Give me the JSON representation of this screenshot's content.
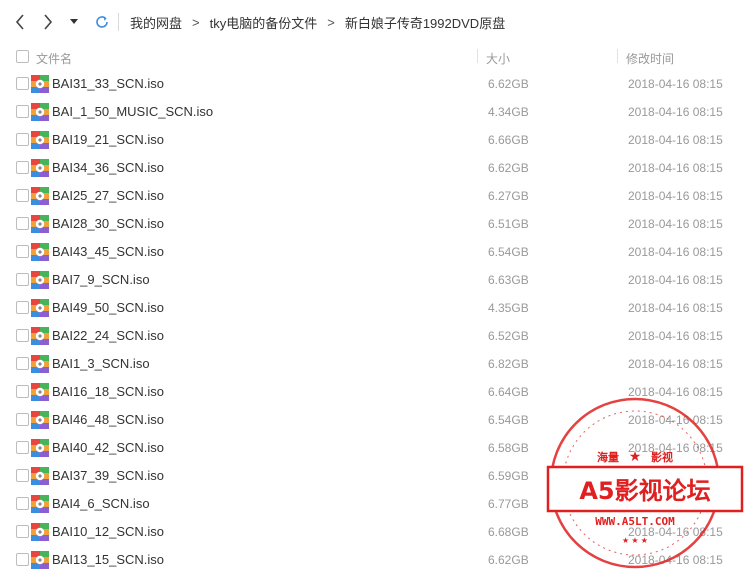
{
  "toolbar": {
    "back_icon": "chevron-left-icon",
    "forward_icon": "chevron-right-icon",
    "history_icon": "caret-down-icon",
    "refresh_icon": "refresh-icon"
  },
  "breadcrumb": [
    "我的网盘",
    "tky电脑的备份文件",
    "新白娘子传奇1992DVD原盘"
  ],
  "columns": {
    "name": "文件名",
    "size": "大小",
    "date": "修改时间"
  },
  "files": [
    {
      "name": "BAI31_33_SCN.iso",
      "size": "6.62GB",
      "date": "2018-04-16 08:15"
    },
    {
      "name": "BAI_1_50_MUSIC_SCN.iso",
      "size": "4.34GB",
      "date": "2018-04-16 08:15"
    },
    {
      "name": "BAI19_21_SCN.iso",
      "size": "6.66GB",
      "date": "2018-04-16 08:15"
    },
    {
      "name": "BAI34_36_SCN.iso",
      "size": "6.62GB",
      "date": "2018-04-16 08:15"
    },
    {
      "name": "BAI25_27_SCN.iso",
      "size": "6.27GB",
      "date": "2018-04-16 08:15"
    },
    {
      "name": "BAI28_30_SCN.iso",
      "size": "6.51GB",
      "date": "2018-04-16 08:15"
    },
    {
      "name": "BAI43_45_SCN.iso",
      "size": "6.54GB",
      "date": "2018-04-16 08:15"
    },
    {
      "name": "BAI7_9_SCN.iso",
      "size": "6.63GB",
      "date": "2018-04-16 08:15"
    },
    {
      "name": "BAI49_50_SCN.iso",
      "size": "4.35GB",
      "date": "2018-04-16 08:15"
    },
    {
      "name": "BAI22_24_SCN.iso",
      "size": "6.52GB",
      "date": "2018-04-16 08:15"
    },
    {
      "name": "BAI1_3_SCN.iso",
      "size": "6.82GB",
      "date": "2018-04-16 08:15"
    },
    {
      "name": "BAI16_18_SCN.iso",
      "size": "6.64GB",
      "date": "2018-04-16 08:15"
    },
    {
      "name": "BAI46_48_SCN.iso",
      "size": "6.54GB",
      "date": "2018-04-16 08:15"
    },
    {
      "name": "BAI40_42_SCN.iso",
      "size": "6.58GB",
      "date": "2018-04-16 08:15"
    },
    {
      "name": "BAI37_39_SCN.iso",
      "size": "6.59GB",
      "date": "2018-04-16 08:15"
    },
    {
      "name": "BAI4_6_SCN.iso",
      "size": "6.77GB",
      "date": "2018-04-16 08:15"
    },
    {
      "name": "BAI10_12_SCN.iso",
      "size": "6.68GB",
      "date": "2018-04-16 08:15"
    },
    {
      "name": "BAI13_15_SCN.iso",
      "size": "6.62GB",
      "date": "2018-04-16 08:15"
    }
  ],
  "watermark": {
    "top_left": "海量",
    "top_right": "影视",
    "title": "A5影视论坛",
    "url": "WWW.A5LT.COM",
    "color": "#e02020"
  }
}
